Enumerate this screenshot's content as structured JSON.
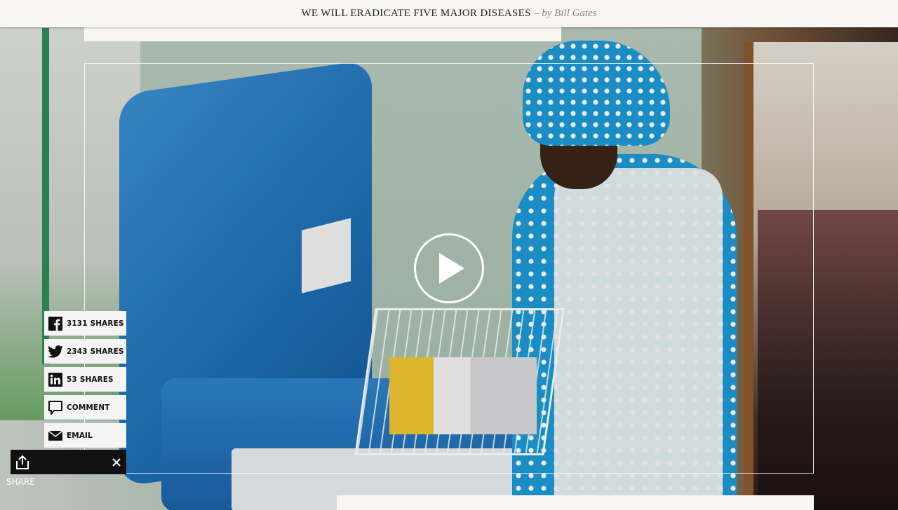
{
  "header": {
    "title": "WE WILL ERADICATE FIVE MAJOR DISEASES",
    "separator": "–",
    "author": "by Bill Gates"
  },
  "video": {
    "play_icon": "play-icon"
  },
  "share": {
    "items": [
      {
        "icon": "facebook-icon",
        "count": "3131",
        "label": "SHARES"
      },
      {
        "icon": "twitter-icon",
        "count": "2343",
        "label": "SHARES"
      },
      {
        "icon": "linkedin-icon",
        "count": "53",
        "label": "SHARES"
      },
      {
        "icon": "comment-icon",
        "count": "",
        "label": "COMMENT"
      },
      {
        "icon": "email-icon",
        "count": "",
        "label": "EMAIL"
      }
    ],
    "toggle_label": "SHARE",
    "share_icon": "share-icon",
    "close_icon": "close-icon"
  },
  "colors": {
    "header_bg": "#f8f6f2",
    "share_item_bg": "#f4f4f4",
    "share_bar_bg": "#111111"
  }
}
